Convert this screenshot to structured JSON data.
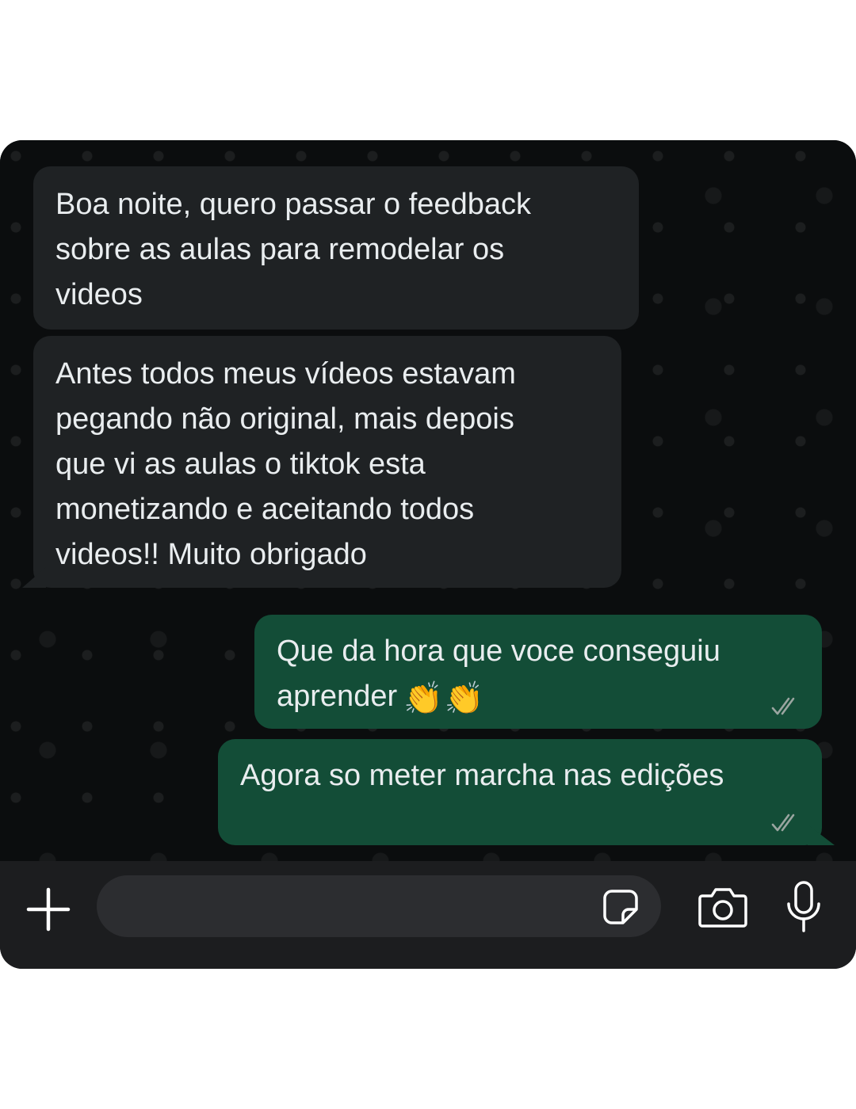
{
  "messages": [
    {
      "direction": "incoming",
      "text": "Boa noite, quero passar o feedback\nsobre as aulas para remodelar os\nvideos"
    },
    {
      "direction": "incoming",
      "text": "Antes todos meus vídeos estavam\npegando não original, mais depois\nque vi as aulas o tiktok esta\nmonetizando e aceitando todos\nvideos!! Muito obrigado"
    },
    {
      "direction": "outgoing",
      "text": "Que da hora que voce conseguiu\naprender",
      "emoji": "👏👏",
      "status": "read"
    },
    {
      "direction": "outgoing",
      "text": "Agora so meter marcha nas edições",
      "status": "read"
    }
  ],
  "composer": {
    "input_value": "",
    "placeholder": "",
    "icons": [
      "plus-icon",
      "sticker-icon",
      "camera-icon",
      "mic-icon"
    ]
  },
  "colors": {
    "background": "#0b0d0e",
    "incoming_bubble": "#1f2224",
    "outgoing_bubble": "#134d37",
    "text": "#e9edef",
    "tick": "#9aa5a0",
    "input_bar": "#1c1d1f"
  }
}
